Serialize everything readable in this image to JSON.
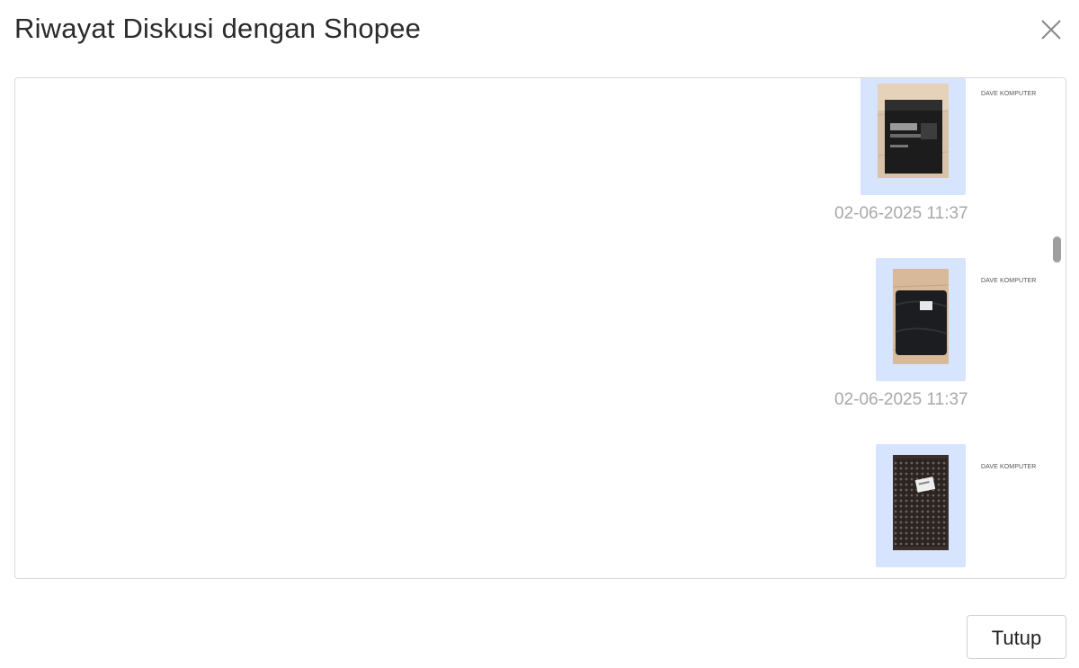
{
  "dialog": {
    "title": "Riwayat Diskusi dengan Shopee",
    "close_button_label": "Tutup",
    "close_icon": "close-icon"
  },
  "messages": [
    {
      "sender": "DAVE KOMPUTER",
      "attachment": "photo of boxed electronic product on tiled floor",
      "timestamp": "02-06-2025 11:37"
    },
    {
      "sender": "DAVE KOMPUTER",
      "attachment": "photo of black wrapped package with shipping label",
      "timestamp": "02-06-2025 11:37"
    },
    {
      "sender": "DAVE KOMPUTER",
      "attachment": "photo of patterned wrapped package with shipping label",
      "timestamp": ""
    }
  ],
  "colors": {
    "bubble": "#d6e4fd",
    "timestamp": "#a8a8a8",
    "border": "#d9d9d9"
  }
}
